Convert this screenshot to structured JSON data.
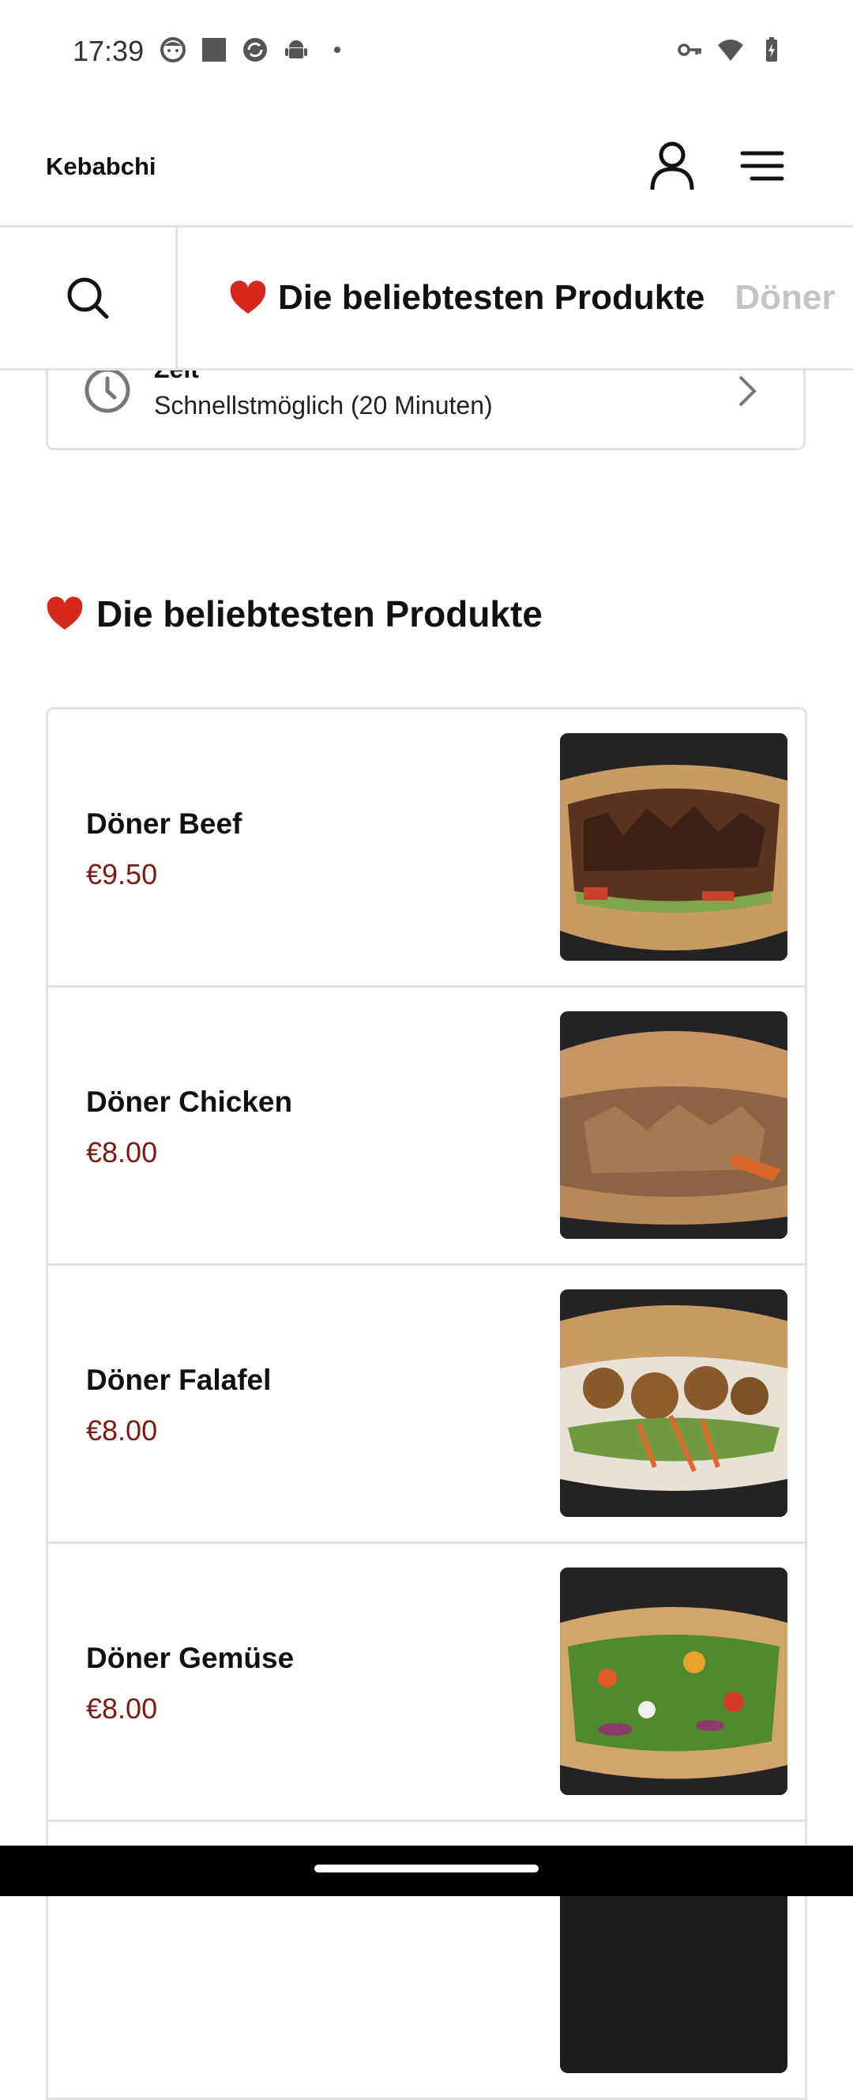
{
  "status_bar": {
    "time": "17:39"
  },
  "header": {
    "brand": "Kebabchi"
  },
  "category_bar": {
    "tabs": [
      {
        "label": "Die beliebtesten Produkte",
        "active": true
      },
      {
        "label": "Döner",
        "active": false
      }
    ]
  },
  "time_card": {
    "label": "Zeit",
    "value": "Schnellstmöglich (20 Minuten)"
  },
  "section": {
    "title": "Die beliebtesten Produkte"
  },
  "products": [
    {
      "name": "Döner Beef",
      "price": "€9.50",
      "image": "doner-beef-photo"
    },
    {
      "name": "Döner Chicken",
      "price": "€8.00",
      "image": "doner-chicken-photo"
    },
    {
      "name": "Döner Falafel",
      "price": "€8.00",
      "image": "doner-falafel-photo"
    },
    {
      "name": "Döner Gemüse",
      "price": "€8.00",
      "image": "doner-gemuese-photo"
    }
  ],
  "colors": {
    "price": "#7a1c14",
    "heart": "#d4281c",
    "inactive_tab": "#c4c4c4",
    "border": "#e2e2e2"
  }
}
